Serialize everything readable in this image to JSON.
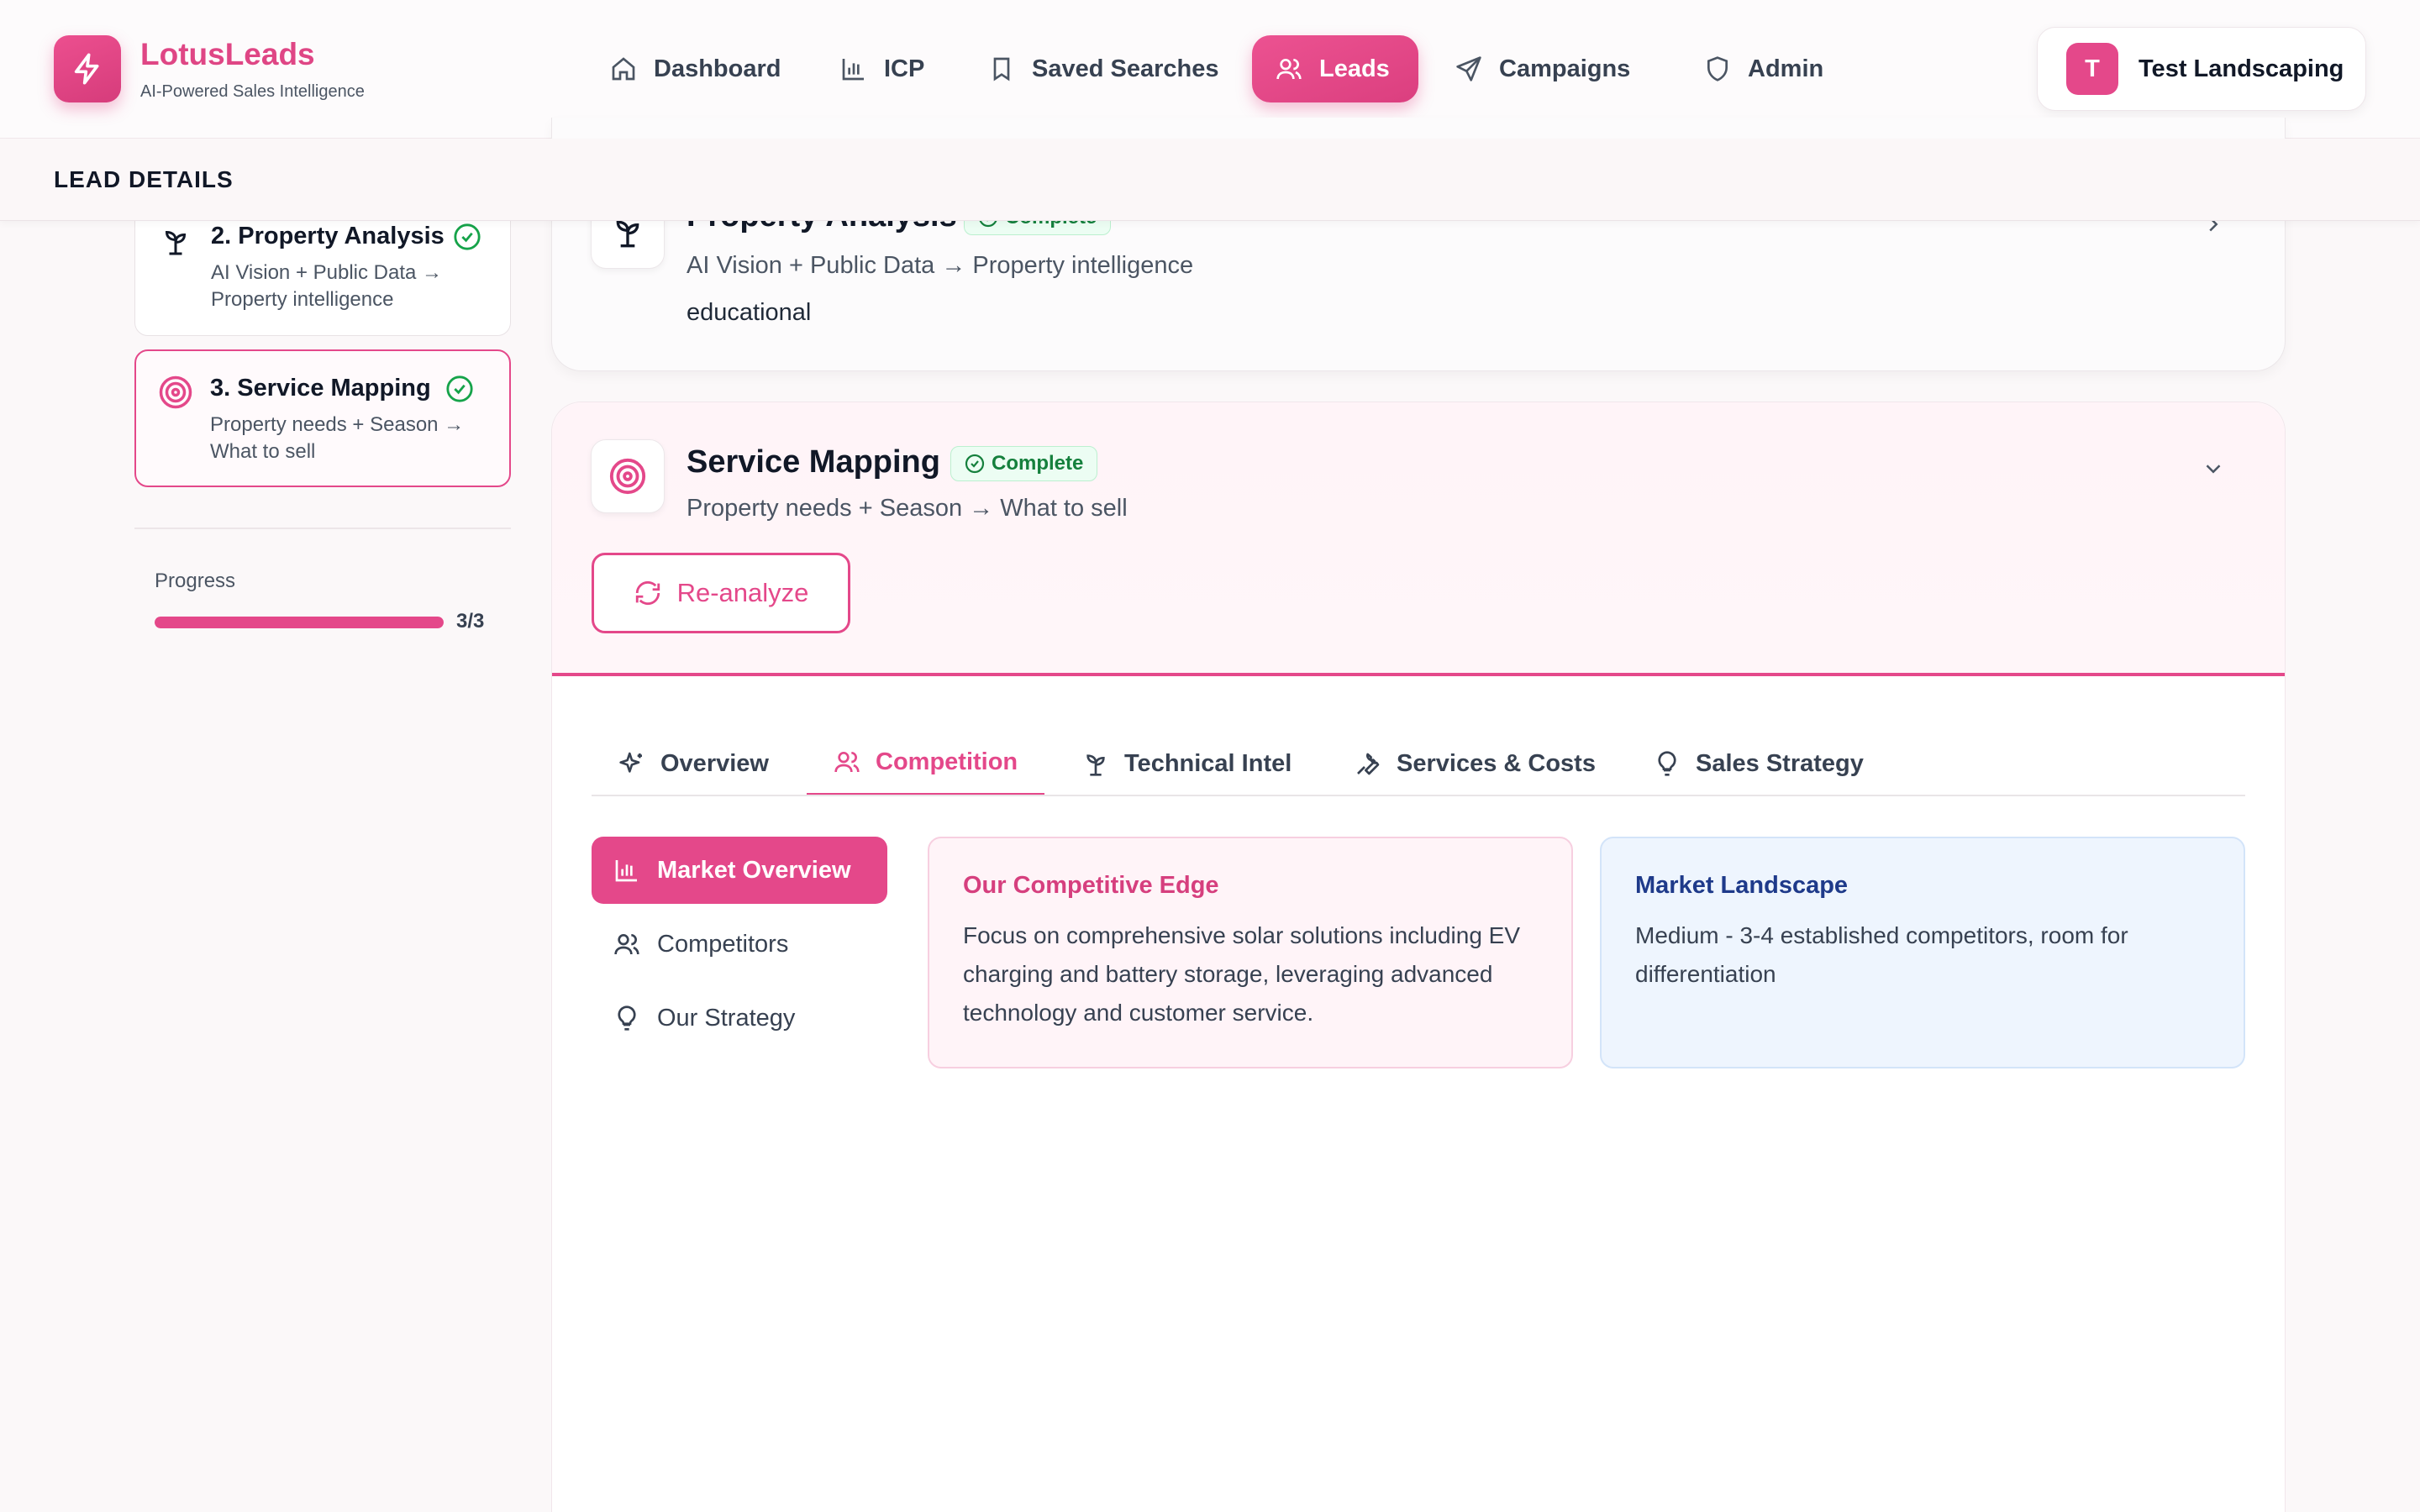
{
  "brand": {
    "name": "LotusLeads",
    "tagline": "AI-Powered Sales Intelligence",
    "accent": "#e4488a"
  },
  "nav": {
    "items": [
      {
        "label": "Dashboard",
        "icon": "home-icon"
      },
      {
        "label": "ICP",
        "icon": "bar-chart-icon"
      },
      {
        "label": "Saved Searches",
        "icon": "bookmark-icon"
      },
      {
        "label": "Leads",
        "icon": "users-icon",
        "active": true
      },
      {
        "label": "Campaigns",
        "icon": "send-icon"
      },
      {
        "label": "Admin",
        "icon": "shield-icon"
      }
    ]
  },
  "user": {
    "initial": "T",
    "name": "Test Landscaping"
  },
  "page": {
    "title": "LEAD DETAILS"
  },
  "steps": [
    {
      "title": "2. Property Analysis",
      "desc": "AI Vision + Public Data → Property intelligence",
      "status": "complete"
    },
    {
      "title": "3. Service Mapping",
      "desc": "Property needs + Season → What to sell",
      "status": "complete",
      "active": true
    }
  ],
  "progress": {
    "label": "Progress",
    "count": "3/3",
    "fraction": 1.0
  },
  "property_panel": {
    "title": "Property Analysis",
    "badge": "Complete",
    "subtitle": "AI Vision + Public Data → Property intelligence",
    "value": "educational"
  },
  "service_panel": {
    "title": "Service Mapping",
    "badge": "Complete",
    "subtitle": "Property needs + Season → What to sell",
    "reanalyze_label": "Re-analyze"
  },
  "tabs": [
    {
      "label": "Overview",
      "icon": "sparkles-icon"
    },
    {
      "label": "Competition",
      "icon": "users-icon",
      "active": true
    },
    {
      "label": "Technical Intel",
      "icon": "sprout-icon"
    },
    {
      "label": "Services & Costs",
      "icon": "wrench-icon"
    },
    {
      "label": "Sales Strategy",
      "icon": "lightbulb-icon"
    }
  ],
  "subnav": [
    {
      "label": "Market Overview",
      "icon": "bar-chart-icon",
      "active": true
    },
    {
      "label": "Competitors",
      "icon": "users-icon"
    },
    {
      "label": "Our Strategy",
      "icon": "lightbulb-icon"
    }
  ],
  "cards": {
    "edge": {
      "title": "Our Competitive Edge",
      "body": "Focus on comprehensive solar solutions including EV charging and battery storage, leveraging advanced technology and customer service."
    },
    "landscape": {
      "title": "Market Landscape",
      "body": "Medium - 3-4 established competitors, room for differentiation"
    }
  }
}
